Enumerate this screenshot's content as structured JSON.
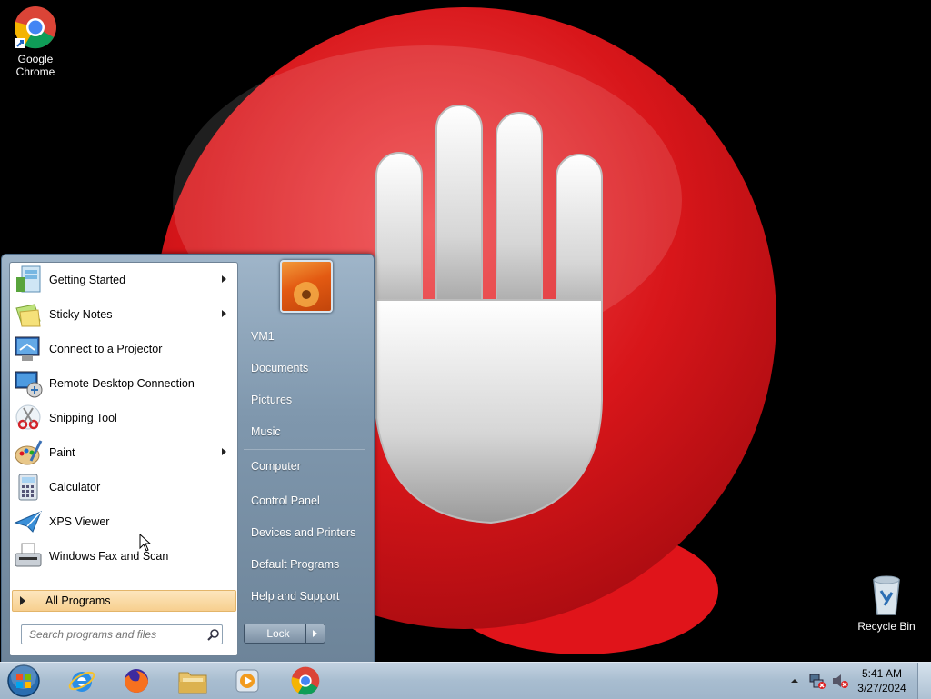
{
  "desktop": {
    "icons": [
      {
        "label_line1": "Google",
        "label_line2": "Chrome"
      },
      {
        "label": "Recycle Bin"
      }
    ]
  },
  "start_menu": {
    "programs": [
      {
        "label": "Getting Started",
        "icon": "getting-started-icon",
        "has_submenu": true
      },
      {
        "label": "Sticky Notes",
        "icon": "sticky-notes-icon",
        "has_submenu": true
      },
      {
        "label": "Connect to a Projector",
        "icon": "projector-icon",
        "has_submenu": false
      },
      {
        "label": "Remote Desktop Connection",
        "icon": "remote-desktop-icon",
        "has_submenu": false
      },
      {
        "label": "Snipping Tool",
        "icon": "scissors-icon",
        "has_submenu": false
      },
      {
        "label": "Paint",
        "icon": "paint-icon",
        "has_submenu": true
      },
      {
        "label": "Calculator",
        "icon": "calculator-icon",
        "has_submenu": false
      },
      {
        "label": "XPS Viewer",
        "icon": "xps-viewer-icon",
        "has_submenu": false
      },
      {
        "label": "Windows Fax and Scan",
        "icon": "fax-scan-icon",
        "has_submenu": false
      }
    ],
    "all_programs": "All Programs",
    "search_placeholder": "Search programs and files",
    "right": [
      {
        "label": "VM1"
      },
      {
        "label": "Documents"
      },
      {
        "label": "Pictures"
      },
      {
        "label": "Music"
      },
      {
        "label": "Computer"
      },
      {
        "label": "Control Panel"
      },
      {
        "label": "Devices and Printers"
      },
      {
        "label": "Default Programs"
      },
      {
        "label": "Help and Support"
      }
    ],
    "lock_button": "Lock"
  },
  "taskbar": {
    "pinned": [
      "start-orb-icon",
      "internet-explorer-icon",
      "firefox-icon",
      "file-explorer-icon",
      "media-player-icon",
      "chrome-icon"
    ],
    "clock_time": "5:41 AM",
    "clock_date": "3/27/2024"
  },
  "colors": {
    "wallpaper_red": "#d8161a",
    "menu_highlight": "#f7cf8f"
  }
}
